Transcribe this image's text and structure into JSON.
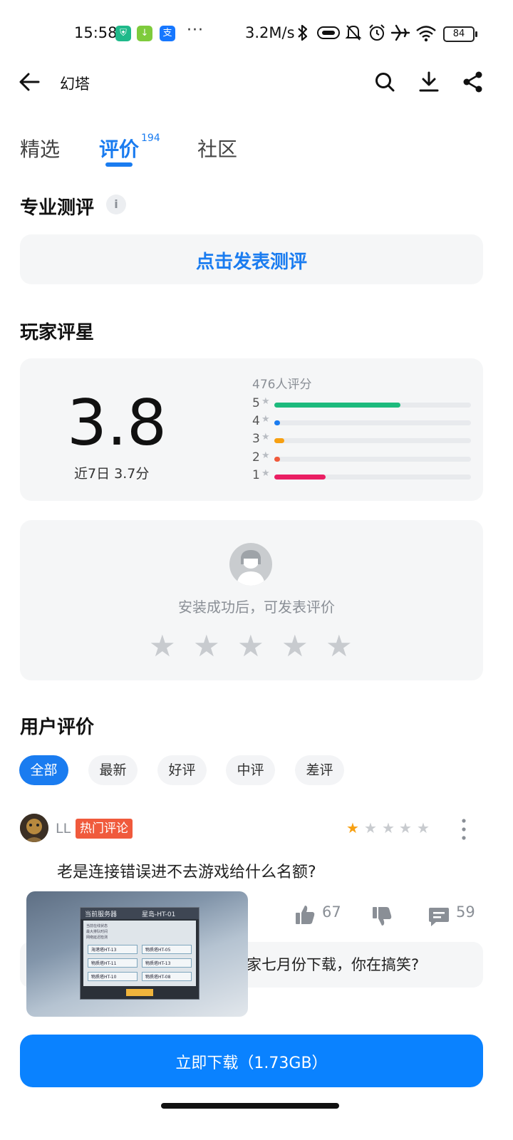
{
  "status_bar": {
    "time": "15:58",
    "dots": "···",
    "net_speed": "3.2M/s",
    "battery": "84"
  },
  "header": {
    "title": "幻塔"
  },
  "tabs": [
    {
      "label": "精选",
      "active": false
    },
    {
      "label": "评价",
      "active": true,
      "badge": "194"
    },
    {
      "label": "社区",
      "active": false
    }
  ],
  "pro_review": {
    "heading": "专业测评",
    "info_glyph": "i",
    "publish_label": "点击发表测评"
  },
  "player_rating": {
    "heading": "玩家评星",
    "score": "3.8",
    "recent": "近7日 3.7分",
    "raters": "476人评分",
    "distribution": [
      {
        "stars": "5",
        "fraction": 0.64,
        "color": "#1dba7d"
      },
      {
        "stars": "4",
        "fraction": 0.03,
        "color": "#1a7cf0"
      },
      {
        "stars": "3",
        "fraction": 0.05,
        "color": "#f7a012"
      },
      {
        "stars": "2",
        "fraction": 0.02,
        "color": "#f05a3c"
      },
      {
        "stars": "1",
        "fraction": 0.26,
        "color": "#ea1e63"
      }
    ]
  },
  "install_prompt": {
    "hint": "安装成功后，可发表评价",
    "star_glyph": "★"
  },
  "user_reviews": {
    "heading": "用户评价",
    "filters": [
      {
        "label": "全部",
        "active": true
      },
      {
        "label": "最新",
        "active": false
      },
      {
        "label": "好评",
        "active": false
      },
      {
        "label": "中评",
        "active": false
      },
      {
        "label": "差评",
        "active": false
      }
    ],
    "review": {
      "username": "LL",
      "badge": "热门评论",
      "rating": 1,
      "text": "老是连接错误进不去游戏给什么名额?",
      "likes": "67",
      "comments": "59",
      "reply_text": "家七月份下载，你在搞笑?"
    }
  },
  "preview": {
    "header_left": "当前服务器",
    "header_right": "星岛-HT-01",
    "lines": [
      "当前在线状态",
      "最大排队时间",
      "网络延迟检测"
    ],
    "buttons": [
      "海港塔HT-13",
      "物质塔HT-05",
      "物质塔HT-11",
      "物质塔HT-13",
      "物质塔HT-10",
      "物质塔HT-08"
    ]
  },
  "download": {
    "label": "立即下载（1.73GB）"
  }
}
